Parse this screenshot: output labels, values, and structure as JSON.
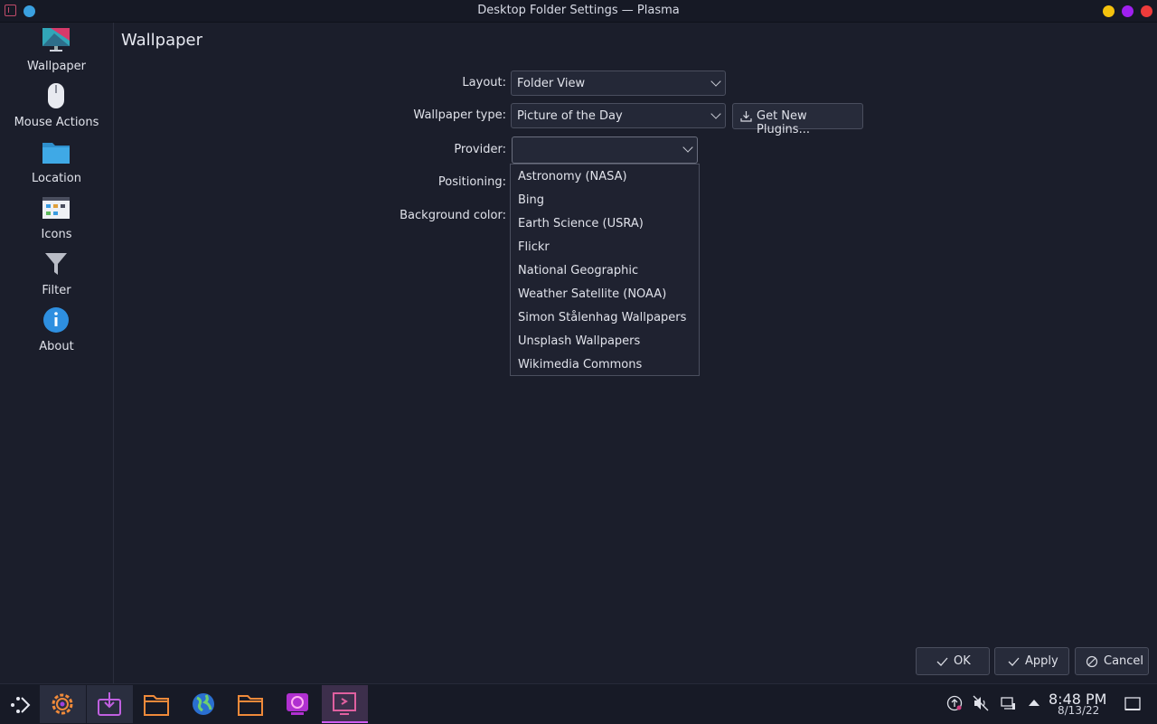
{
  "window": {
    "title": "Desktop Folder Settings — Plasma"
  },
  "titlebar_controls": [
    {
      "name": "minimize",
      "color": "#f4c20d"
    },
    {
      "name": "maximize",
      "color": "#a020f0"
    },
    {
      "name": "close",
      "color": "#ee3b3b"
    }
  ],
  "sidebar": {
    "items": [
      {
        "label": "Wallpaper",
        "icon": "wallpaper-icon"
      },
      {
        "label": "Mouse Actions",
        "icon": "mouse-icon"
      },
      {
        "label": "Location",
        "icon": "folder-icon"
      },
      {
        "label": "Icons",
        "icon": "icons-icon"
      },
      {
        "label": "Filter",
        "icon": "filter-icon"
      },
      {
        "label": "About",
        "icon": "info-icon"
      }
    ]
  },
  "page": {
    "title": "Wallpaper"
  },
  "form": {
    "layout_label": "Layout:",
    "layout_value": "Folder View",
    "wallpaper_type_label": "Wallpaper type:",
    "wallpaper_type_value": "Picture of the Day",
    "get_plugins_label": "Get New Plugins...",
    "provider_label": "Provider:",
    "provider_value": "",
    "positioning_label": "Positioning:",
    "background_color_label": "Background color:"
  },
  "provider_options": [
    "Astronomy (NASA)",
    "Bing",
    "Earth Science (USRA)",
    "Flickr",
    "National Geographic",
    "Weather Satellite (NOAA)",
    "Simon Stålenhag Wallpapers",
    "Unsplash Wallpapers",
    "Wikimedia Commons"
  ],
  "dialog_buttons": {
    "ok": "OK",
    "apply": "Apply",
    "cancel": "Cancel"
  },
  "taskbar": {
    "apps": [
      "app-launcher",
      "system-settings",
      "discover",
      "dolphin",
      "browser",
      "files",
      "konsole-like",
      "plasma-settings"
    ],
    "clock": {
      "time": "8:48 PM",
      "date": "8/13/22"
    }
  },
  "colors": {
    "accent": "#d05cf0",
    "background": "#1b1e2b"
  }
}
